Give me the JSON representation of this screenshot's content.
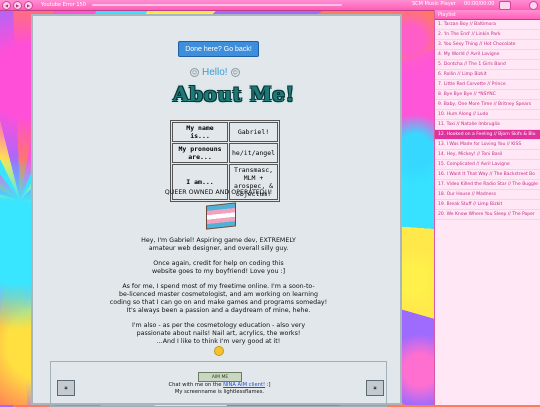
{
  "topbar": {
    "title": "Youtube Error 150",
    "right_label": "SCM Music Player",
    "time": "00:00/00:00",
    "play_glyph": "▶",
    "prev_glyph": "◀",
    "next_glyph": "▶"
  },
  "main": {
    "back_button": "Done here? Go back!",
    "hello": "Hello!",
    "about_title": "About Me!",
    "table": [
      {
        "key": "My name is...",
        "value": "Gabriel!"
      },
      {
        "key": "My pronouns are...",
        "value": "he/it/angel"
      },
      {
        "key": "I am...",
        "value": "Transmasc, MLM + arospec, & objectum!"
      }
    ],
    "queer_line": "QUEER OWNED AND OPERATED!!!",
    "para1_line1": "Hey, I'm Gabriel! Aspiring game dev, EXTREMELY",
    "para1_line2": "amateur web designer, and overall silly guy.",
    "para2_line1": "Once again, credit for help on coding this",
    "para2_line2": "website goes to my boyfriend! Love you :]",
    "para3_line1": "As for me, I spend most of my freetime online. I'm a soon-to-",
    "para3_line2": "be-licenced master cosmetologist, and am working on learning",
    "para3_line3": "coding so that I can go on and make games and programs someday!",
    "para3_line4": "It's always been a passion and a daydream of mine, hehe.",
    "para4_line1": "I'm also - as per the cosmetology education - also very",
    "para4_line2": "passionate about nails! Nail art, acrylics, the works!",
    "para4_line3": "...And I like to think I'm very good at it!"
  },
  "footer": {
    "aim_button": "AIM ME",
    "chat_prefix": "Chat with me on the ",
    "chat_link": "NINA AIM client!",
    "chat_suffix": " :]",
    "screenname": "My screenname is lightlessflames."
  },
  "playlist": {
    "header": "Playlist",
    "items": [
      "1. Tarzan Boy // Baltimora",
      "2. 'In The End' // Linkin Park",
      "3. You Sexy Thing // Hot Chocolate",
      "4. My World // Avril Lavigne",
      "5. Dontcha // The 1 Girls Band",
      "6. Rollin // Limp Bizkit",
      "7. Little Red Corvette // Prince",
      "8. Bye Bye Bye // *NSYNC",
      "9. Baby, One More Time // Britney Spears",
      "10. Hum Along // Ludo",
      "11. Toxi // Natalie Imbruglia",
      "12. Hooked on a Feeling // Bjorn Skifs & Blu",
      "13. I Was Made for Loving You // KISS",
      "14. Hey, Mickey! // Toni Basil",
      "15. Complicated // Avril Lavigne",
      "16. I Want It That Way // The Backstreet Bo",
      "17. Video Killed the Radio Star // The Buggle",
      "18. Our House // Madness",
      "19. Break Stuff // Limp Bizkit",
      "20. We Know Where You Sleep // The Paper"
    ],
    "active_index": 11
  },
  "colors": {
    "accent_pink": "#ff5fb7",
    "button_blue": "#3d8edb",
    "panel_bg": "#e1e7ea"
  }
}
